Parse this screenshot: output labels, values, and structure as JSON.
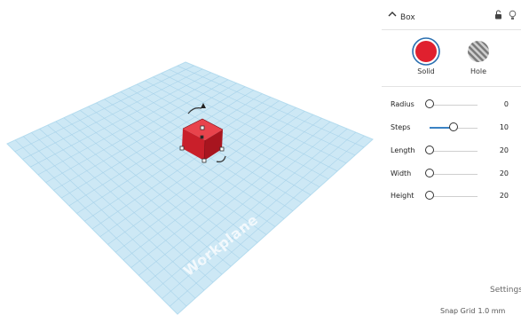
{
  "workplane": {
    "label": "Workplane"
  },
  "shape_panel": {
    "title": "Box",
    "types": [
      {
        "label": "Solid",
        "color": "#e0202e"
      },
      {
        "label": "Hole"
      }
    ],
    "parameters": [
      {
        "label": "Radius",
        "value": "0",
        "slider_fraction": 0.0
      },
      {
        "label": "Steps",
        "value": "10",
        "slider_fraction": 0.5
      },
      {
        "label": "Length",
        "value": "20",
        "slider_fraction": 0.0
      },
      {
        "label": "Width",
        "value": "20",
        "slider_fraction": 0.0
      },
      {
        "label": "Height",
        "value": "20",
        "slider_fraction": 0.0
      }
    ]
  },
  "footer": {
    "settings_label": "Settings",
    "snap_grid_label": "Snap Grid",
    "snap_grid_value": "1.0 mm"
  },
  "colors": {
    "workplane_fill": "#cde8f5",
    "grid_line": "#a7d2ea",
    "box_red": "#d9232e",
    "slider_accent": "#3b82c4"
  },
  "icons": [
    "chevron-up-icon",
    "lock-icon",
    "lightbulb-icon",
    "rotate-arrow-icon",
    "lift-cone-icon"
  ]
}
